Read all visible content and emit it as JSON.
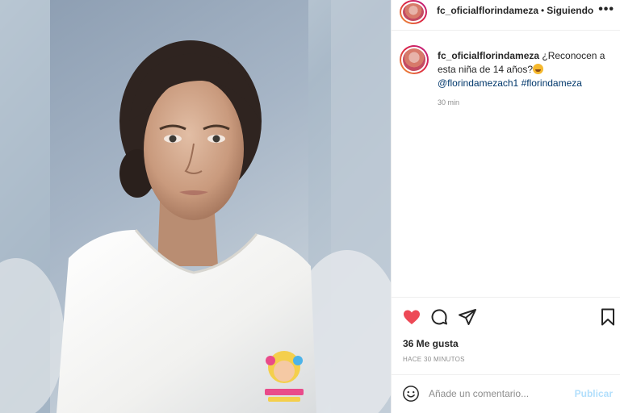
{
  "header": {
    "username": "fc_oficialflorindameza",
    "separator": "•",
    "follow_status": "Siguiendo",
    "more": "•••"
  },
  "caption": {
    "username": "fc_oficialflorindameza",
    "text": "¿Reconocen a esta niña de 14 años?",
    "mention": "@florindamezach1",
    "hashtag": "#florindameza",
    "time": "30 min"
  },
  "actions": {
    "likes": "36 Me gusta",
    "posted_ago": "HACE 30 MINUTOS",
    "like_color": "#ed4956"
  },
  "comment": {
    "placeholder": "Añade un comentario...",
    "publish_label": "Publicar"
  },
  "icons": [
    "heart-icon",
    "comment-icon",
    "share-icon",
    "bookmark-icon",
    "emoji-icon"
  ]
}
